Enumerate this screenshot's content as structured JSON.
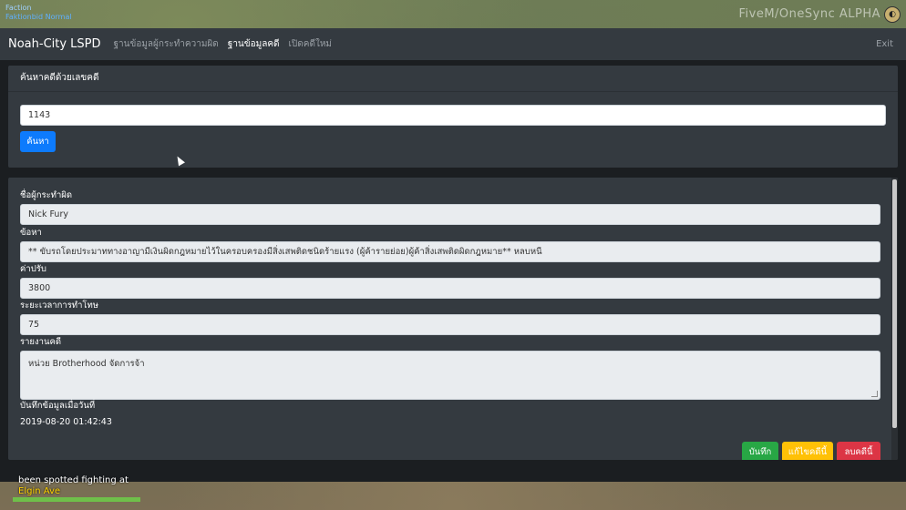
{
  "hud": {
    "top_left_line1": "Faction",
    "top_left_line2": "Faktionbid Normal",
    "top_right": "FiveM/OneSync ALPHA",
    "notification_line1": "been spotted fighting at",
    "notification_location": "Elgin Ave",
    "health_fraction": 1.0
  },
  "navbar": {
    "brand": "Noah-City LSPD",
    "links": [
      "ฐานข้อมูลผู้กระทำความผิด",
      "ฐานข้อมูลคดี",
      "เปิดคดีใหม่"
    ],
    "active_index": 1,
    "exit": "Exit"
  },
  "search": {
    "header": "ค้นหาคดีด้วยเลขคดี",
    "value": "1143",
    "button": "ค้นหา"
  },
  "record": {
    "offender_label": "ชื่อผู้กระทำผิด",
    "offender_value": "Nick Fury",
    "charge_label": "ข้อหา",
    "charge_value": "** ขับรถโดยประมาททางอาญามีเงินผิดกฎหมายไว้ในครอบครองมีสิ่งเสพติดชนิดร้ายแรง (ผู้ค้ารายย่อย)ผู้ค้าสิ่งเสพติดผิดกฎหมาย** หลบหนี",
    "fine_label": "ค่าปรับ",
    "fine_value": "3800",
    "jail_label": "ระยะเวลาการทำโทษ",
    "jail_value": "75",
    "report_label": "รายงานคดี",
    "report_value": "หน่วย Brotherhood จัดการจ้า",
    "saved_label": "บันทึกข้อมูลเมื่อวันที่",
    "saved_value": "2019-08-20 01:42:43",
    "buttons": {
      "save": "บันทึก",
      "edit": "แก้ไขคดีนี้",
      "delete": "ลบคดีนี้"
    }
  },
  "colors": {
    "navbar_bg": "#343a40",
    "primary": "#0d7bfd",
    "success": "#28a745",
    "warning": "#ffc107",
    "danger": "#dc3545"
  }
}
